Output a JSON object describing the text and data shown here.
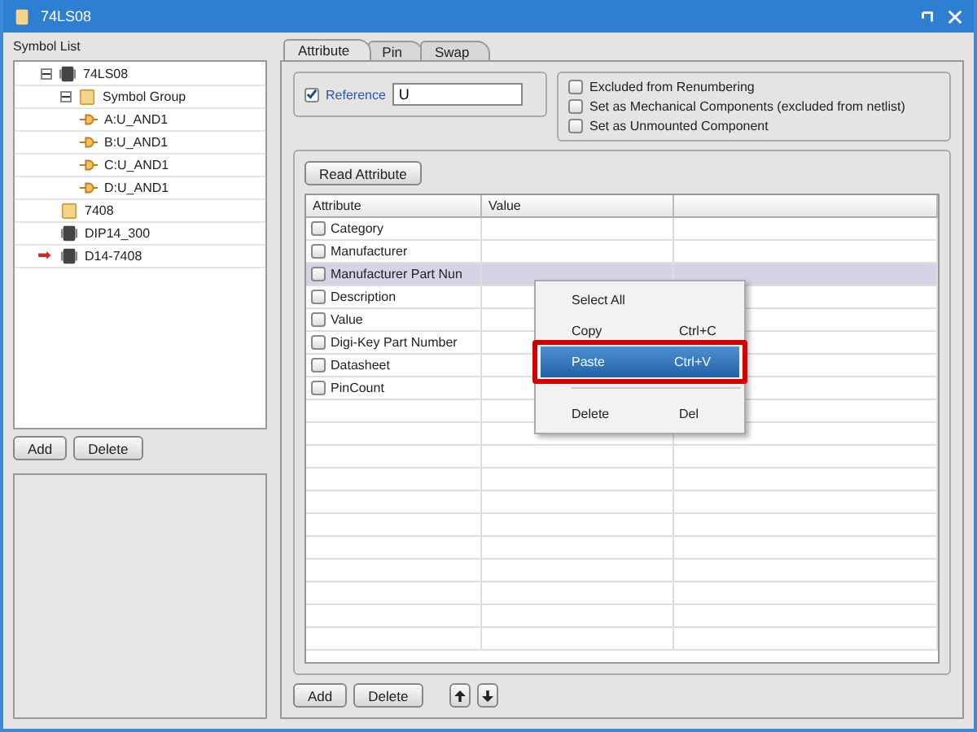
{
  "window": {
    "title": "74LS08"
  },
  "symbol_list": {
    "label": "Symbol List",
    "items": [
      {
        "label": "74LS08",
        "kind": "chip",
        "expanded": true,
        "pointer": false,
        "children": [
          {
            "label": "Symbol Group",
            "kind": "folder",
            "expanded": true,
            "pointer": false,
            "children": [
              {
                "label": "A:U_AND1",
                "kind": "gate",
                "pointer": false
              },
              {
                "label": "B:U_AND1",
                "kind": "gate",
                "pointer": false
              },
              {
                "label": "C:U_AND1",
                "kind": "gate",
                "pointer": false
              },
              {
                "label": "D:U_AND1",
                "kind": "gate",
                "pointer": false
              }
            ]
          },
          {
            "label": "7408",
            "kind": "folder",
            "pointer": false
          },
          {
            "label": "DIP14_300",
            "kind": "chip",
            "pointer": false
          },
          {
            "label": "D14-7408",
            "kind": "chip",
            "pointer": true,
            "pointer_glyph": "➡"
          }
        ]
      }
    ],
    "buttons": [
      "Add",
      "Delete"
    ]
  },
  "tabs": [
    {
      "label": "Attribute",
      "selected": true
    },
    {
      "label": "Pin",
      "selected": false
    },
    {
      "label": "Swap",
      "selected": false
    }
  ],
  "reference": {
    "label": "Reference",
    "checked": true,
    "value": "U"
  },
  "options": [
    {
      "label": "Excluded from Renumbering",
      "checked": false
    },
    {
      "label": "Set as Mechanical Components (excluded from netlist)",
      "checked": false
    },
    {
      "label": "Set as Unmounted Component",
      "checked": false
    }
  ],
  "read_button": "Read Attribute",
  "table": {
    "columns": [
      "Attribute",
      "Value"
    ],
    "rows": [
      {
        "attribute": "Category",
        "checked": false,
        "selected": false
      },
      {
        "attribute": "Manufacturer",
        "checked": false,
        "selected": false
      },
      {
        "attribute": "Manufacturer Part Nun",
        "checked": false,
        "selected": true
      },
      {
        "attribute": "Description",
        "checked": false,
        "selected": false
      },
      {
        "attribute": "Value",
        "checked": false,
        "selected": false
      },
      {
        "attribute": "Digi-Key Part Number",
        "checked": false,
        "selected": false
      },
      {
        "attribute": "Datasheet",
        "checked": false,
        "selected": false
      },
      {
        "attribute": "PinCount",
        "checked": false,
        "selected": false
      }
    ]
  },
  "context_menu": [
    {
      "kind": "item",
      "label": "Select All",
      "selected": false
    },
    {
      "kind": "item",
      "label": "Copy",
      "shortcut": "Ctrl+C",
      "selected": false
    },
    {
      "kind": "item",
      "label": "Paste",
      "shortcut": "Ctrl+V",
      "selected": true,
      "highlighted": true
    },
    {
      "kind": "separator"
    },
    {
      "kind": "item",
      "label": "Delete",
      "shortcut": "Del",
      "selected": false
    }
  ],
  "bottom_buttons": [
    "Add",
    "Delete"
  ]
}
